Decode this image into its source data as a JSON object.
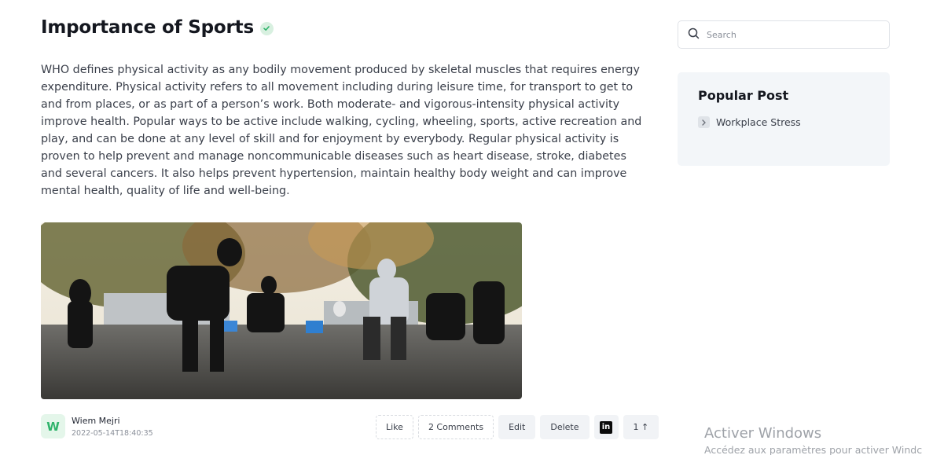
{
  "post": {
    "title": "Importance of Sports",
    "verified_icon": "check-circle-icon",
    "body": "WHO defines physical activity as any bodily movement produced by skeletal muscles that requires energy expenditure. Physical activity refers to all movement including during leisure time, for transport to get to and from places, or as part of a person’s work. Both moderate- and vigorous-intensity physical activity improve health. Popular ways to be active include walking, cycling, wheeling, sports, active recreation and play, and can be done at any level of skill and for enjoyment by everybody. Regular physical activity is proven to help prevent and manage noncommunicable diseases such as heart disease, stroke, diabetes and several cancers. It also helps prevent hypertension, maintain healthy body weight and can improve mental health, quality of life and well-being."
  },
  "author": {
    "initial": "W",
    "name": "Wiem Mejri",
    "date": "2022-05-14T18:40:35"
  },
  "actions": {
    "like": "Like",
    "comments": "2 Comments",
    "edit": "Edit",
    "delete": "Delete",
    "linkedin_icon": "linkedin-icon",
    "linkedin_letters": "in",
    "upvote": "1 ↑"
  },
  "search": {
    "placeholder": "Search",
    "icon": "search-icon"
  },
  "sidebar": {
    "popular_title": "Popular Post",
    "items": [
      {
        "label": "Workplace Stress",
        "icon": "chevron-right-icon"
      }
    ]
  },
  "watermark": {
    "title": "Activer Windows",
    "subtitle": "Accédez aux paramètres pour activer Windc"
  },
  "colors": {
    "accent_green": "#2fb36b",
    "panel_bg": "#f3f6f9"
  }
}
